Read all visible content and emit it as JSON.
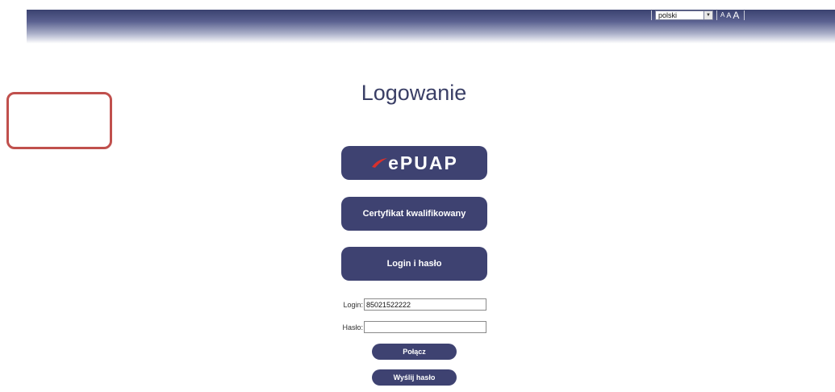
{
  "header": {
    "language": "polski",
    "font_sizes": [
      "A",
      "A",
      "A"
    ]
  },
  "page": {
    "title": "Logowanie"
  },
  "methods": {
    "epuap_logo": "ePUAP",
    "certificate_label": "Certyfikat kwalifikowany",
    "login_password_label": "Login i hasło"
  },
  "form": {
    "login_label": "Login:",
    "login_value": "85021522222",
    "password_label": "Hasło:",
    "password_value": "",
    "connect_label": "Połącz",
    "send_password_label": "Wyślij hasło"
  },
  "colors": {
    "button": "#3e4271",
    "title": "#3a3f66",
    "highlight_frame": "#c0504d"
  }
}
